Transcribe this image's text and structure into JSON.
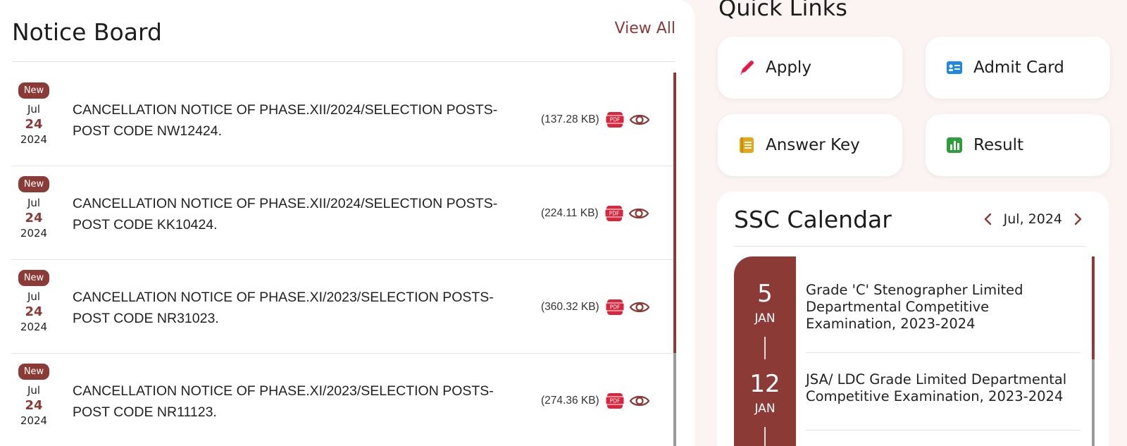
{
  "notice_board": {
    "title": "Notice Board",
    "view_all_label": "View All",
    "badge_label": "New",
    "pdf_label": "PDF",
    "items": [
      {
        "month": "Jul",
        "day": "24",
        "year": "2024",
        "text": "CANCELLATION NOTICE OF PHASE.XII/2024/SELECTION POSTS-POST CODE NW12424.",
        "size": "(137.28 KB)"
      },
      {
        "month": "Jul",
        "day": "24",
        "year": "2024",
        "text": "CANCELLATION NOTICE OF PHASE.XII/2024/SELECTION POSTS-POST CODE KK10424.",
        "size": "(224.11 KB)"
      },
      {
        "month": "Jul",
        "day": "24",
        "year": "2024",
        "text": "CANCELLATION NOTICE OF PHASE.XI/2023/SELECTION POSTS-POST CODE NR31023.",
        "size": "(360.32 KB)"
      },
      {
        "month": "Jul",
        "day": "24",
        "year": "2024",
        "text": "CANCELLATION NOTICE OF PHASE.XI/2023/SELECTION POSTS-POST CODE NR11123.",
        "size": "(274.36 KB)"
      }
    ]
  },
  "quick_links": {
    "title": "Quick Links",
    "items": [
      {
        "label": "Apply",
        "icon": "pencil-icon",
        "color": "#e6194b"
      },
      {
        "label": "Admit Card",
        "icon": "id-card-icon",
        "color": "#1e88e5"
      },
      {
        "label": "Answer Key",
        "icon": "document-icon",
        "color": "#e5a81a"
      },
      {
        "label": "Result",
        "icon": "bar-chart-icon",
        "color": "#2e9e3a"
      }
    ]
  },
  "calendar": {
    "title": "SSC Calendar",
    "month_label": "Jul, 2024",
    "events": [
      {
        "day": "5",
        "month": "JAN",
        "text": "Grade 'C' Stenographer Limited Departmental Competitive Examination, 2023-2024"
      },
      {
        "day": "12",
        "month": "JAN",
        "text": "JSA/ LDC Grade Limited Departmental Competitive Examination, 2023-2024"
      }
    ]
  },
  "colors": {
    "accent": "#8b3a36",
    "background": "#fbf4f2"
  }
}
